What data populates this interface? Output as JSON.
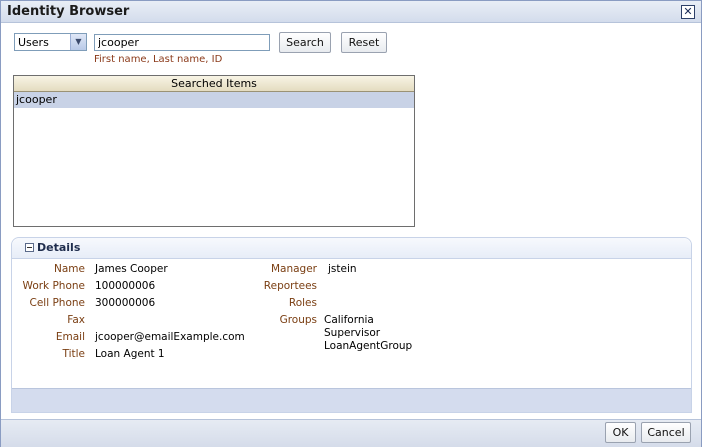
{
  "dialog": {
    "title": "Identity Browser",
    "close_glyph": "✕"
  },
  "search": {
    "type_selected": "Users",
    "query_value": "jcooper",
    "hint": "First name, Last name, ID",
    "search_label": "Search",
    "reset_label": "Reset"
  },
  "results": {
    "header": "Searched Items",
    "rows": [
      "jcooper"
    ]
  },
  "details": {
    "title": "Details",
    "left_fields": [
      {
        "label": "Name",
        "value": "James Cooper"
      },
      {
        "label": "Work Phone",
        "value": "100000006"
      },
      {
        "label": "Cell Phone",
        "value": "300000006"
      },
      {
        "label": "Fax",
        "value": ""
      },
      {
        "label": "Email",
        "value": "jcooper@emailExample.com"
      },
      {
        "label": "Title",
        "value": "Loan Agent 1"
      }
    ],
    "right_fields": [
      {
        "label": "Manager",
        "value": "jstein"
      },
      {
        "label": "Reportees",
        "value": ""
      },
      {
        "label": "Roles",
        "value": ""
      },
      {
        "label": "Groups",
        "values": [
          "California",
          "Supervisor",
          "LoanAgentGroup"
        ]
      }
    ]
  },
  "footer": {
    "ok_label": "OK",
    "cancel_label": "Cancel"
  }
}
